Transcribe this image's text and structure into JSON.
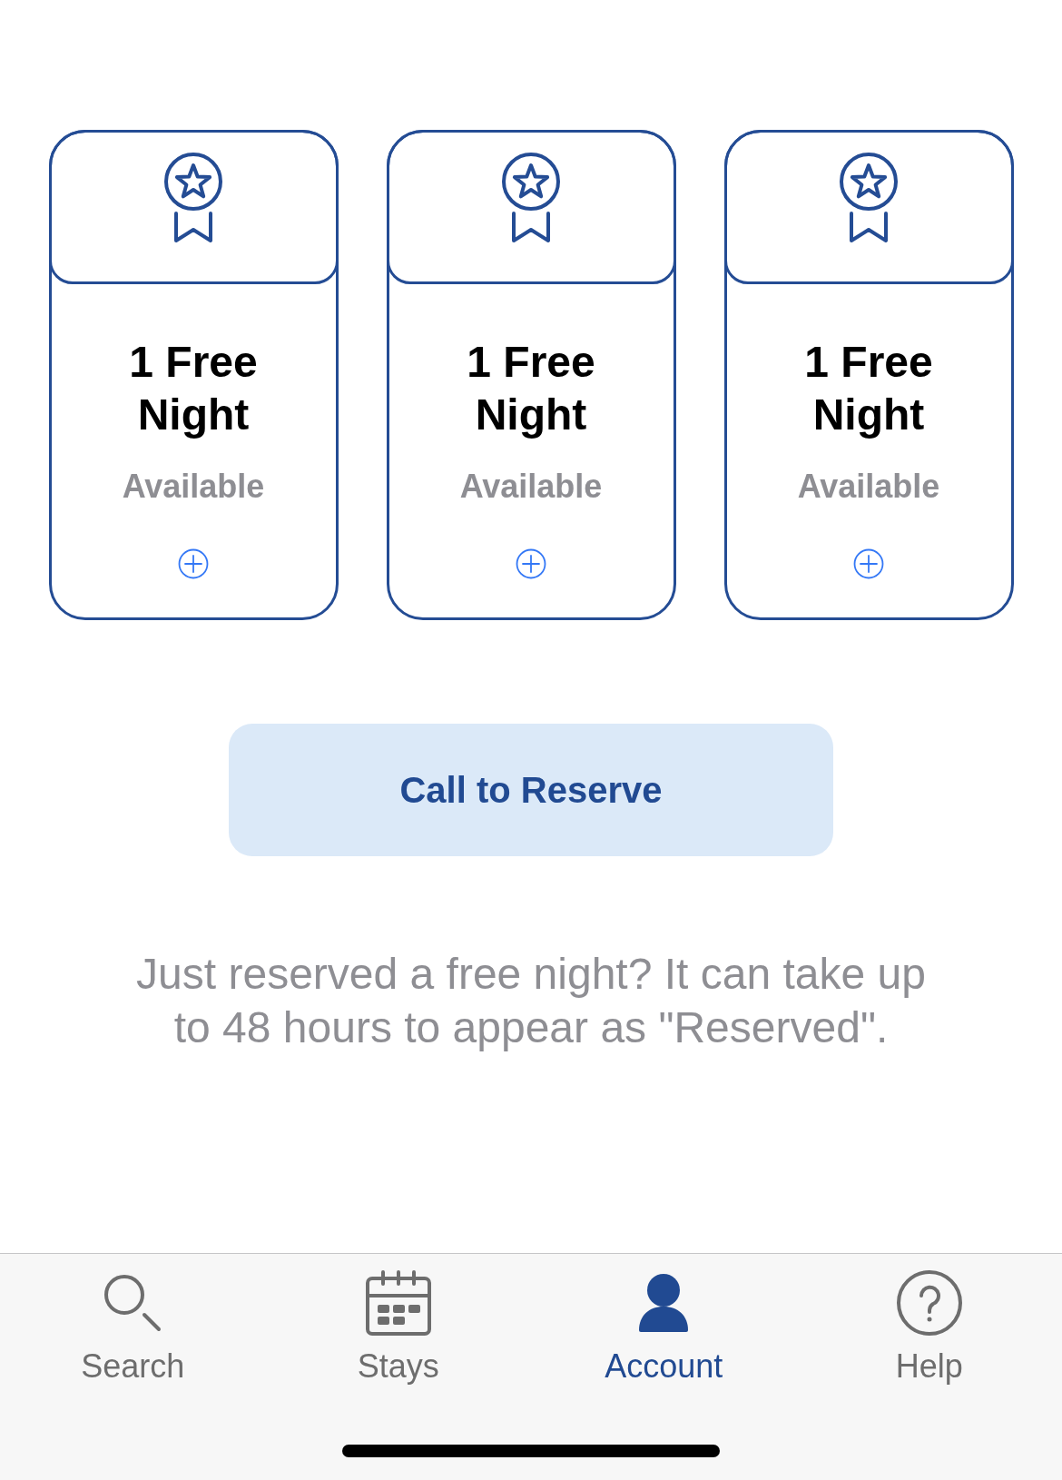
{
  "cards": [
    {
      "title": "1 Free Night",
      "status": "Available"
    },
    {
      "title": "1 Free Night",
      "status": "Available"
    },
    {
      "title": "1 Free Night",
      "status": "Available"
    }
  ],
  "reserve_button": {
    "label": "Call to Reserve"
  },
  "note": "Just reserved a free night? It can take up to 48 hours to appear as \"Reserved\".",
  "tab_bar": {
    "tabs": [
      {
        "kind": "search",
        "label": "Search",
        "selected": false
      },
      {
        "kind": "stays",
        "label": "Stays",
        "selected": false
      },
      {
        "kind": "account",
        "label": "Account",
        "selected": true
      },
      {
        "kind": "help",
        "label": "Help",
        "selected": false
      }
    ]
  }
}
